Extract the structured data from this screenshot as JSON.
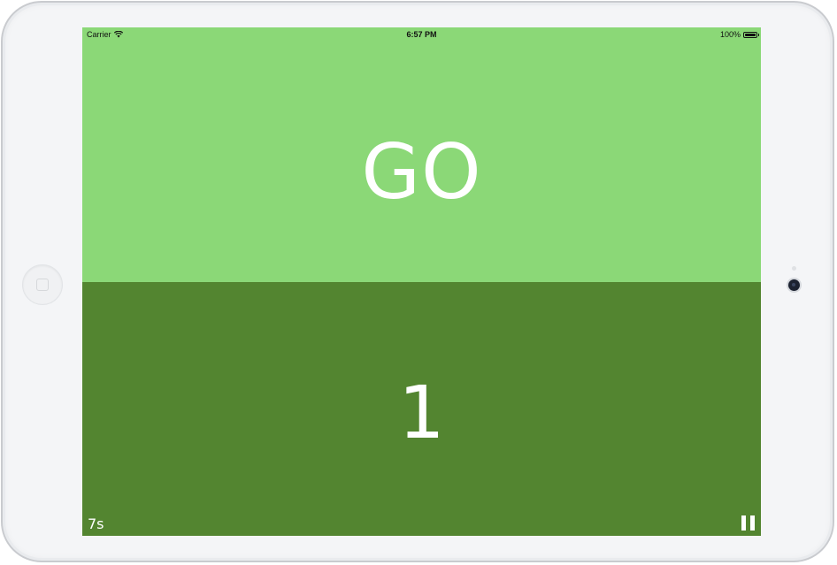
{
  "status_bar": {
    "carrier": "Carrier",
    "time": "6:57 PM",
    "battery": "100%",
    "battery_level": 1.0
  },
  "top_panel": {
    "label": "GO",
    "color": "#8bd877"
  },
  "bottom_panel": {
    "count": "1",
    "color": "#538530",
    "elapsed": "7s"
  },
  "icons": {
    "wifi": "wifi-icon",
    "battery": "battery-icon",
    "pause": "pause-icon"
  }
}
